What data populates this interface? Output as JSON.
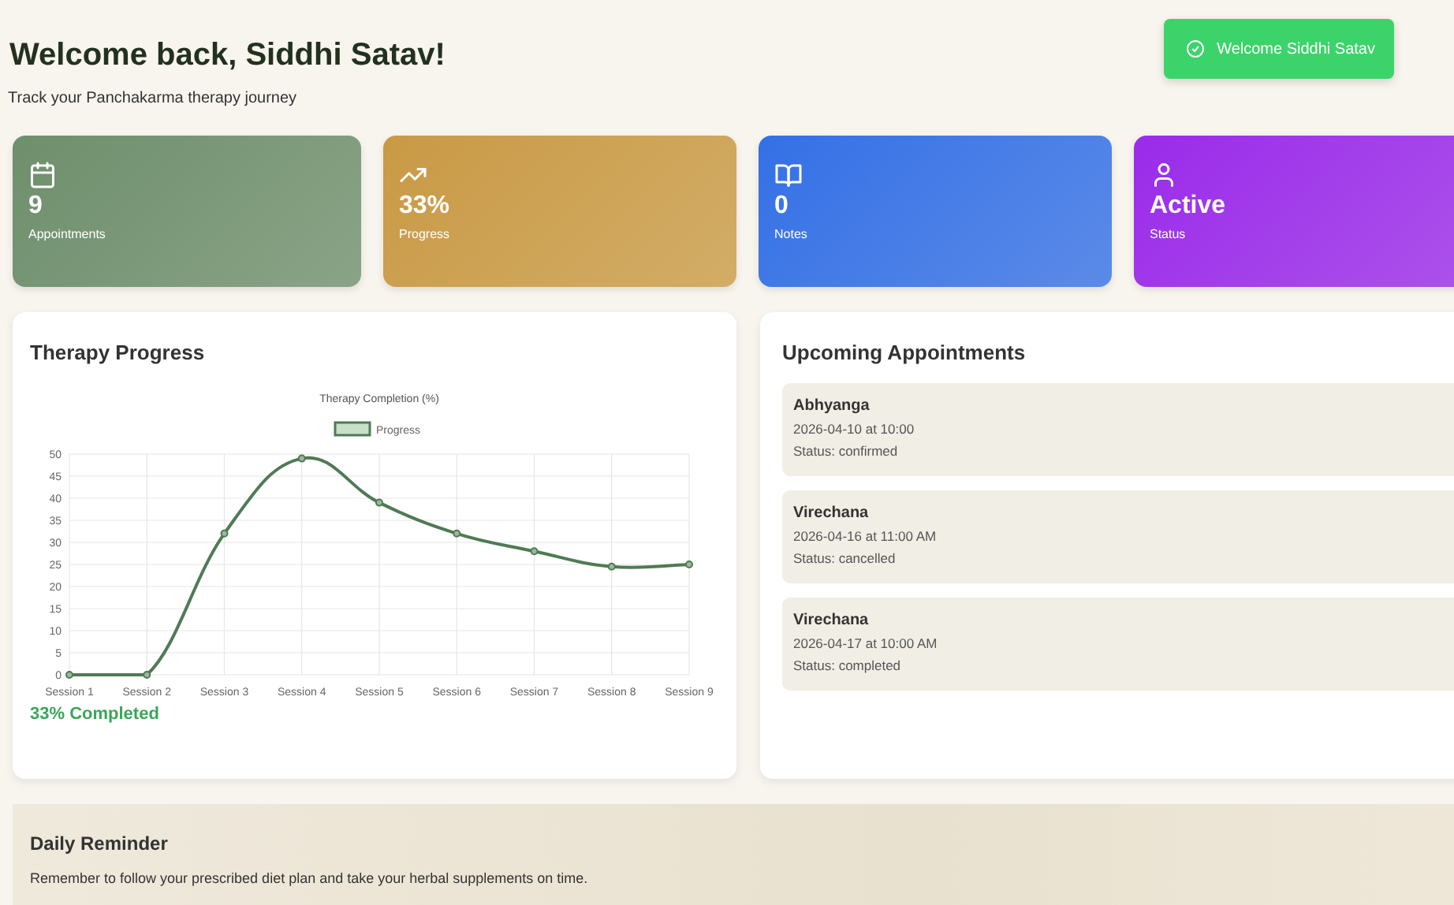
{
  "header": {
    "title": "Welcome back, Siddhi Satav!",
    "subtitle": "Track your Panchakarma therapy journey"
  },
  "toast": {
    "text": "Welcome Siddhi Satav"
  },
  "stats": [
    {
      "kind": "calendar",
      "value": "9",
      "label": "Appointments",
      "color": "#6e8f6c"
    },
    {
      "kind": "trend",
      "value": "33%",
      "label": "Progress",
      "color": "#c99a45"
    },
    {
      "kind": "book",
      "value": "0",
      "label": "Notes",
      "color": "#3470e6"
    },
    {
      "kind": "user",
      "value": "Active",
      "label": "Status",
      "color": "#9a2bea"
    }
  ],
  "progress": {
    "title": "Therapy Progress",
    "completed": "33% Completed",
    "chart_data": {
      "type": "line",
      "title": "Therapy Completion (%)",
      "categories": [
        "Session 1",
        "Session 2",
        "Session 3",
        "Session 4",
        "Session 5",
        "Session 6",
        "Session 7",
        "Session 8",
        "Session 9"
      ],
      "series": [
        {
          "name": "Progress",
          "color": "#4f7a55",
          "marker": true,
          "values": [
            0,
            0,
            32,
            49,
            39,
            32,
            28,
            24.5,
            25
          ]
        }
      ],
      "ylim": [
        0,
        50
      ],
      "grid": true,
      "yticks": [
        0,
        5,
        10,
        15,
        20,
        25,
        30,
        35,
        40,
        45,
        50
      ]
    }
  },
  "appointments": {
    "title": "Upcoming Appointments",
    "items": [
      {
        "name": "Abhyanga",
        "when": "2026-04-10 at 10:00",
        "status": "Status: confirmed"
      },
      {
        "name": "Virechana",
        "when": "2026-04-16 at 11:00 AM",
        "status": "Status: cancelled"
      },
      {
        "name": "Virechana",
        "when": "2026-04-17 at 10:00 AM",
        "status": "Status: completed"
      }
    ]
  },
  "reminder": {
    "title": "Daily Reminder",
    "text": "Remember to follow your prescribed diet plan and take your herbal supplements on time."
  }
}
